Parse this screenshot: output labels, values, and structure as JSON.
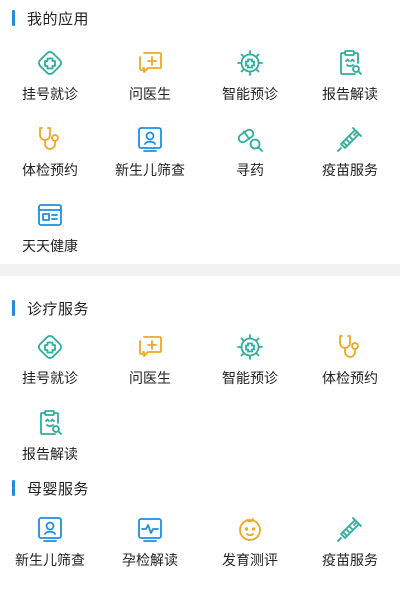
{
  "colors": {
    "accent": "#1E8FE0",
    "teal": "#2CAE9E",
    "orange": "#F0A824",
    "blue": "#1E8FE0",
    "divider": "#f2f2f2"
  },
  "sections": [
    {
      "title": "我的应用",
      "items": [
        {
          "label": "挂号就诊",
          "icon": "medical-cross-icon"
        },
        {
          "label": "问医生",
          "icon": "chat-plus-icon"
        },
        {
          "label": "智能预诊",
          "icon": "smart-diagnosis-icon"
        },
        {
          "label": "报告解读",
          "icon": "report-search-icon"
        },
        {
          "label": "体检预约",
          "icon": "stethoscope-icon"
        },
        {
          "label": "新生儿筛查",
          "icon": "newborn-id-icon"
        },
        {
          "label": "寻药",
          "icon": "pill-search-icon"
        },
        {
          "label": "疫苗服务",
          "icon": "syringe-icon"
        },
        {
          "label": "天天健康",
          "icon": "newspaper-icon"
        }
      ]
    },
    {
      "title": "诊疗服务",
      "items": [
        {
          "label": "挂号就诊",
          "icon": "medical-cross-icon"
        },
        {
          "label": "问医生",
          "icon": "chat-plus-icon"
        },
        {
          "label": "智能预诊",
          "icon": "smart-diagnosis-icon"
        },
        {
          "label": "体检预约",
          "icon": "stethoscope-icon"
        },
        {
          "label": "报告解读",
          "icon": "report-search-icon"
        }
      ]
    },
    {
      "title": "母婴服务",
      "items": [
        {
          "label": "新生儿筛查",
          "icon": "newborn-id-icon"
        },
        {
          "label": "孕检解读",
          "icon": "pulse-monitor-icon"
        },
        {
          "label": "发育测评",
          "icon": "baby-face-icon"
        },
        {
          "label": "疫苗服务",
          "icon": "syringe-icon"
        }
      ]
    }
  ]
}
